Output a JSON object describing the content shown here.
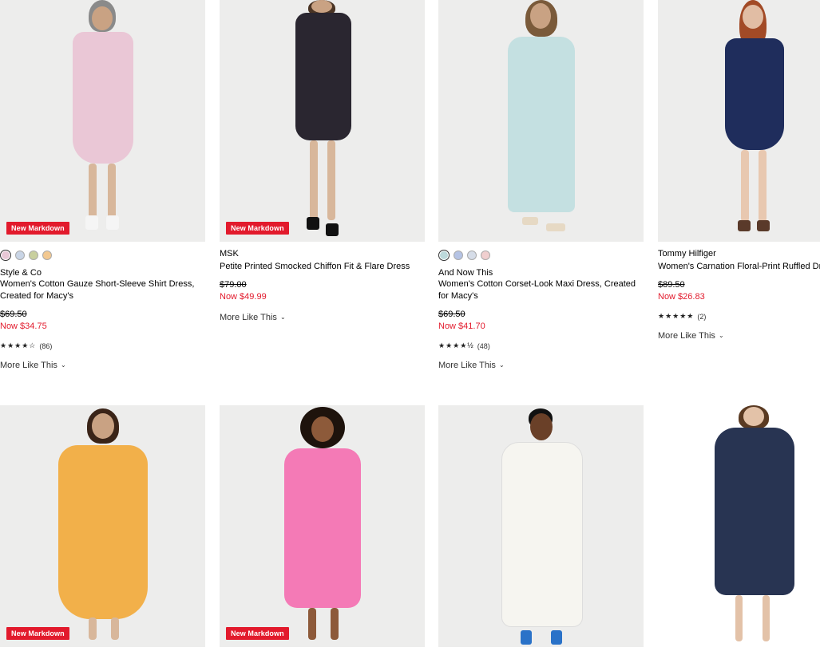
{
  "badges": {
    "new_markdown": "New Markdown"
  },
  "more_like_this": "More Like This",
  "products": [
    {
      "brand": "Style & Co",
      "name": "Women's Cotton Gauze Short-Sleeve Shirt Dress, Created for Macy's",
      "was": "$69.50",
      "now": "Now $34.75",
      "rating_stars": 4,
      "rating_count": "(86)",
      "swatch_colors": [
        "#e8c8d6",
        "#c9d5e6",
        "#c8cf9e",
        "#f2c890"
      ],
      "dress_color": "#eac7d6"
    },
    {
      "brand": "MSK",
      "name": "Petite Printed Smocked Chiffon Fit & Flare Dress",
      "was": "$79.00",
      "now": "Now $49.99",
      "dress_color": "#2a2630"
    },
    {
      "brand": "And Now This",
      "name": "Women's Cotton Corset-Look Maxi Dress, Created for Macy's",
      "was": "$69.50",
      "now": "Now $41.70",
      "rating_stars": 4.5,
      "rating_count": "(48)",
      "swatch_colors": [
        "#bcd9db",
        "#b5c3e4",
        "#d6dde8",
        "#f0cfcf"
      ],
      "dress_color": "#c4e0e1"
    },
    {
      "brand": "Tommy Hilfiger",
      "name": "Women's Carnation Floral-Print Ruffled Dr",
      "was": "$89.50",
      "now": "Now $26.83",
      "rating_stars": 5,
      "rating_count": "(2)",
      "dress_color": "#1f2d5c"
    },
    {
      "dress_color": "#f2b04a"
    },
    {
      "dress_color": "#f47ab6"
    },
    {
      "dress_color": "#f6f5f0"
    },
    {
      "dress_color": "#283452"
    }
  ]
}
